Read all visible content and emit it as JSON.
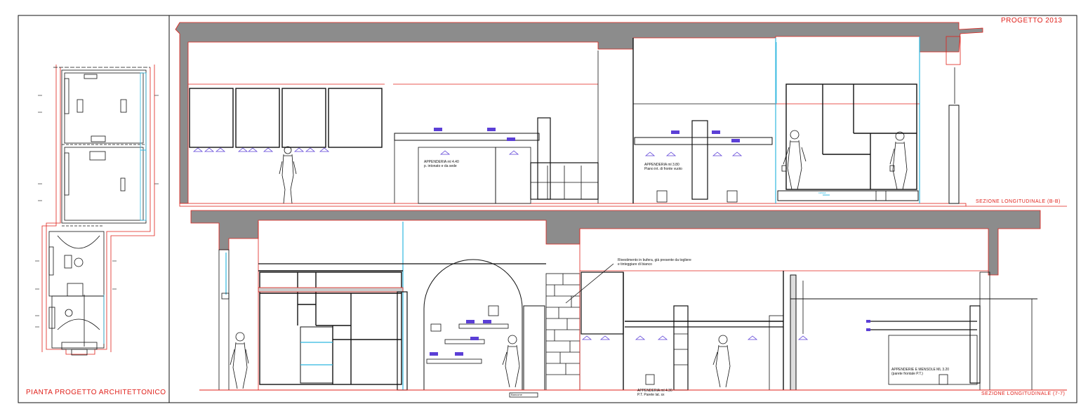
{
  "sheet": {
    "plan_title": "PIANTA PROGETTO ARCHITETTONICO",
    "project_title": "PROGETTO 2013"
  },
  "section_bb": {
    "title": "SEZIONE LONGITUDINALE (B-B)",
    "note_1_line1": "APPENDERIA  ml  4.40",
    "note_1_line2": "p. intonato e da sede",
    "note_2_line1": "APPENDERIA  ml  3.80",
    "note_2_line2": "Piano int. di fronte vuoto",
    "small_tag": "cassa"
  },
  "section_77": {
    "title": "SEZIONE LONGITUDINALE (7-7)",
    "note_3_line1": "Rivestimento in bufera, già presente da togliere",
    "note_3_line2": "e tinteggiare di bianco",
    "note_4_line1": "APPENDERIA  ml  4.30",
    "note_4_line2": "P.T. Parete lat. sx",
    "note_5_line1": "APPENDERIE E MENSOLE  ML  3.20",
    "note_5_line2": "(parete frontale P.T.)",
    "base_tag": "Bancone"
  },
  "colors": {
    "line": "#111111",
    "red": "#e0201a",
    "wall_fill": "#8c8c8c",
    "cyan": "#2fb8e0",
    "purple": "#5b3fd6"
  }
}
